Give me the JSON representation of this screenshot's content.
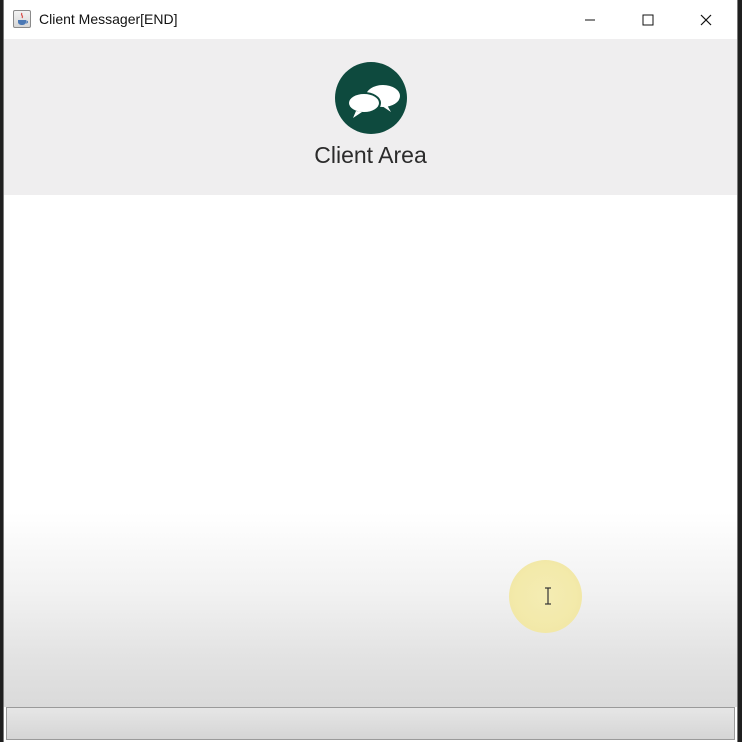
{
  "window": {
    "title": "Client Messager[END]",
    "app_icon": "java-coffee-icon",
    "controls": {
      "minimize_icon": "minimize-icon",
      "maximize_icon": "maximize-icon",
      "close_icon": "close-icon"
    }
  },
  "header": {
    "logo_icon": "chat-bubbles-icon",
    "logo_color": "#0e4a3e",
    "label": "Client Area",
    "background": "#efeeef"
  },
  "content": {
    "messages": []
  },
  "input": {
    "value": "",
    "placeholder": ""
  }
}
